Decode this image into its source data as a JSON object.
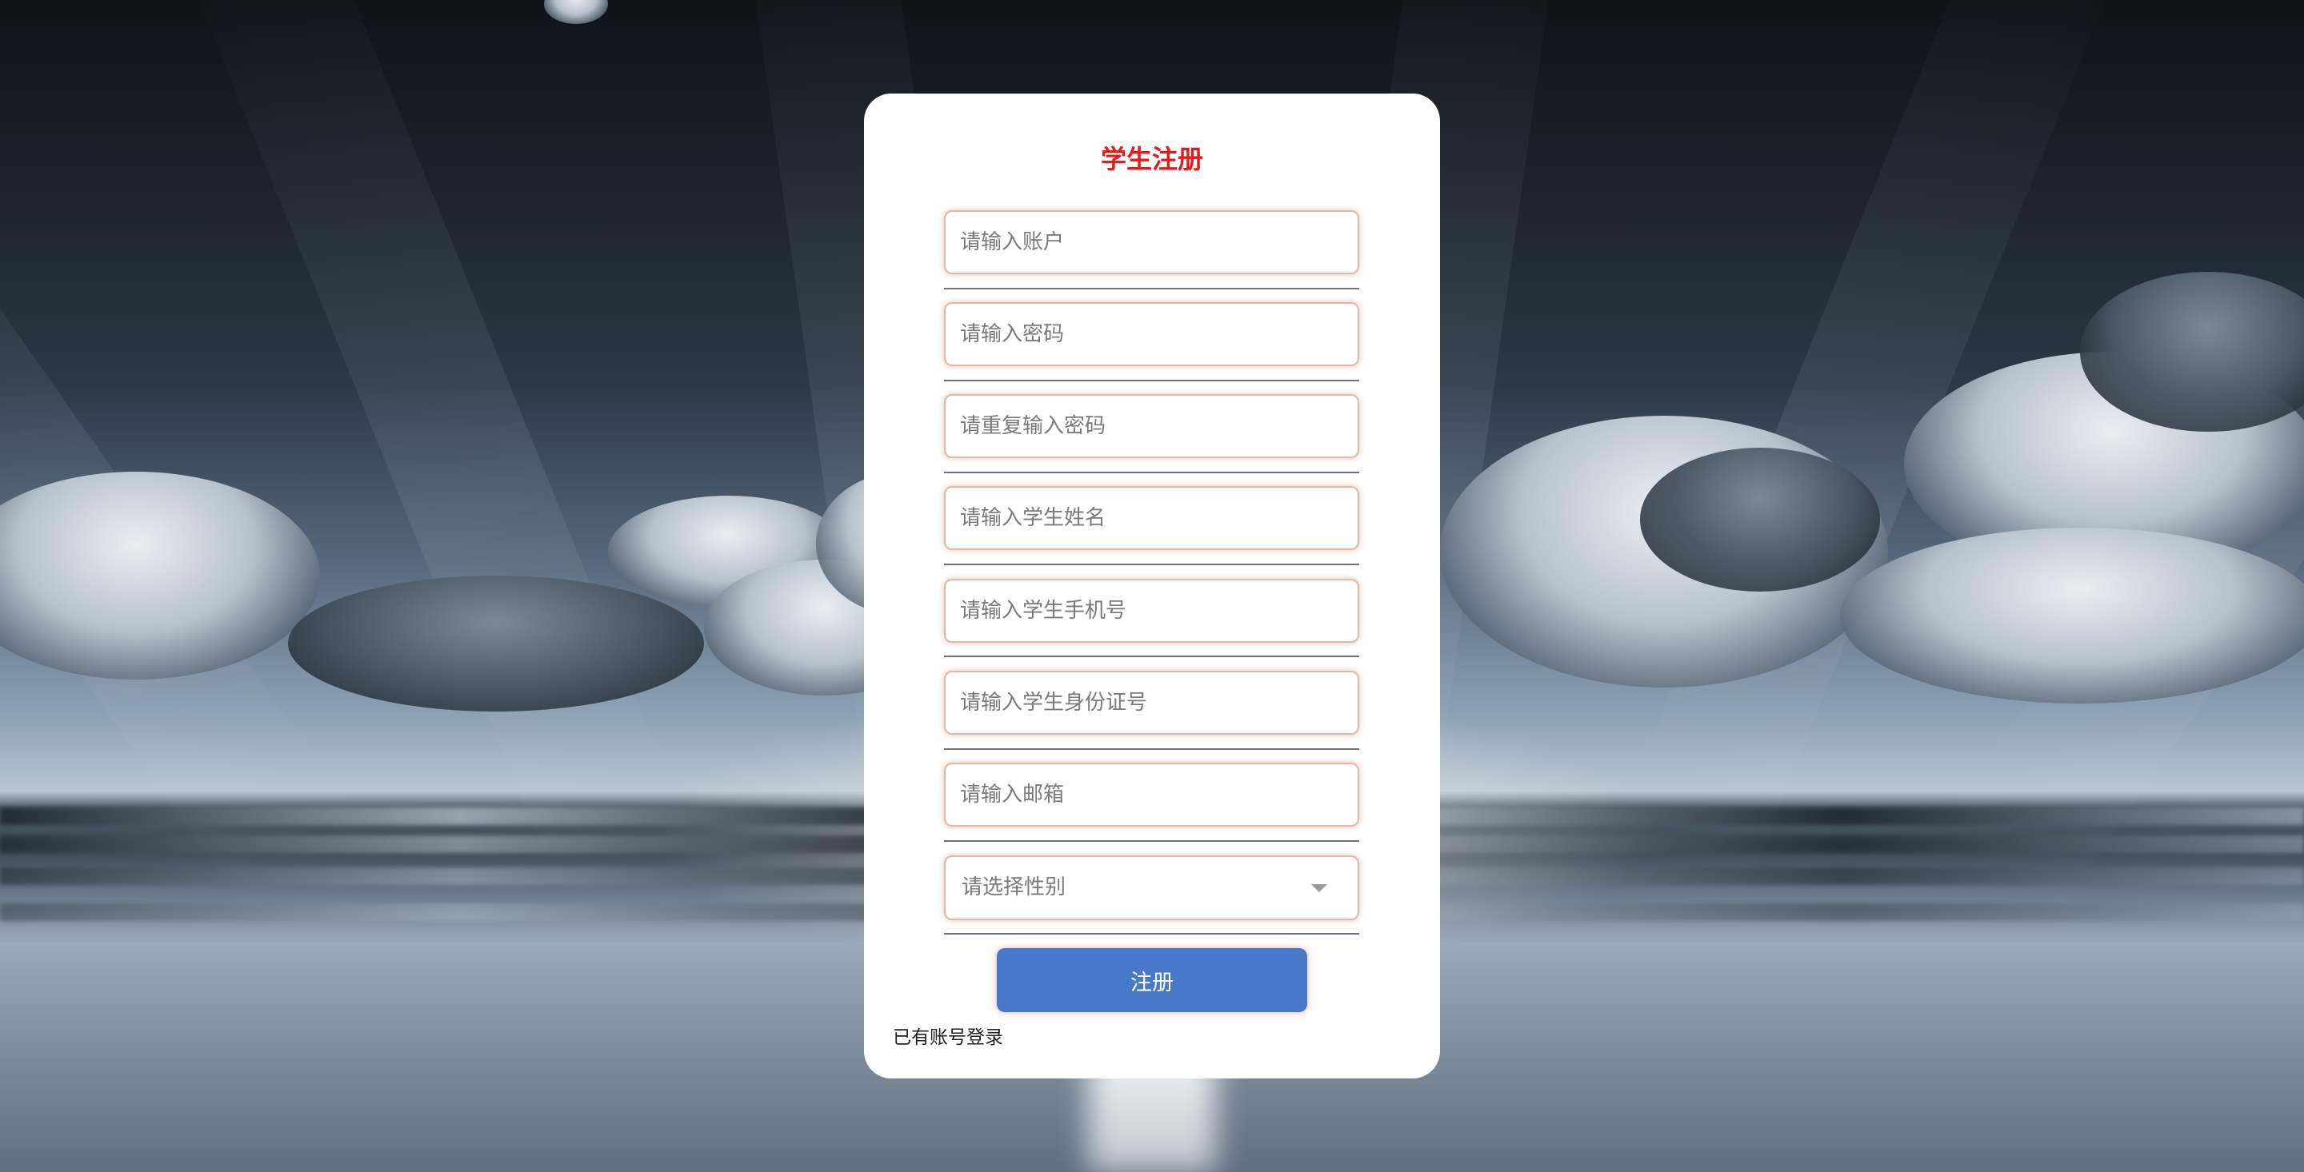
{
  "form": {
    "title": "学生注册",
    "fields": [
      {
        "placeholder": "请输入账户",
        "value": ""
      },
      {
        "placeholder": "请输入密码",
        "value": ""
      },
      {
        "placeholder": "请重复输入密码",
        "value": ""
      },
      {
        "placeholder": "请输入学生姓名",
        "value": ""
      },
      {
        "placeholder": "请输入学生手机号",
        "value": ""
      },
      {
        "placeholder": "请输入学生身份证号",
        "value": ""
      },
      {
        "placeholder": "请输入邮箱",
        "value": ""
      }
    ],
    "gender_select": {
      "placeholder": "请选择性别"
    },
    "submit_label": "注册",
    "login_link": "已有账号登录"
  },
  "colors": {
    "title": "#e31b1b",
    "button": "#4779c8",
    "field_border": "#e6b6a6"
  }
}
